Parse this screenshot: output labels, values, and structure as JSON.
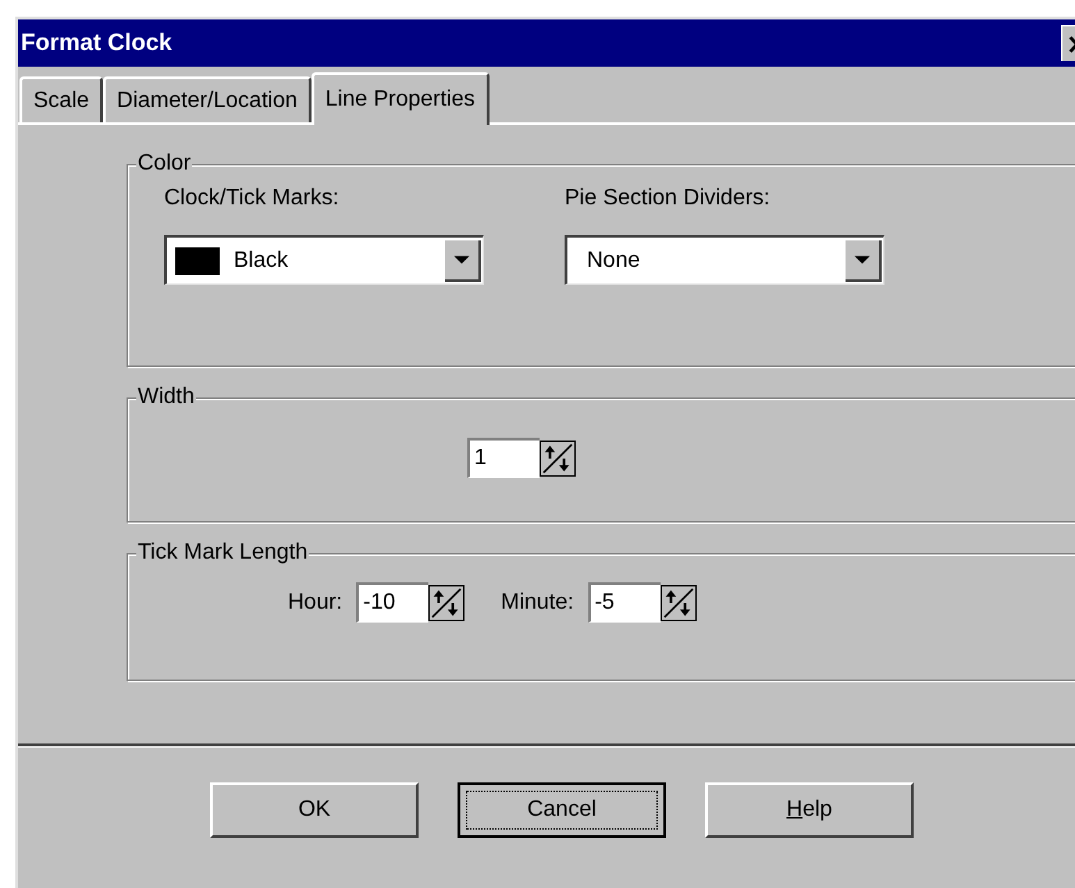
{
  "window": {
    "title": "Format Clock"
  },
  "tabs": [
    {
      "label": "Scale",
      "selected": false
    },
    {
      "label": "Diameter/Location",
      "selected": false
    },
    {
      "label": "Line Properties",
      "selected": true
    }
  ],
  "color_group": {
    "title": "Color",
    "fields": [
      {
        "label": "Clock/Tick Marks:",
        "value": "Black",
        "color": "#000000"
      },
      {
        "label": "Pie Section Dividers:",
        "value": "None"
      }
    ]
  },
  "width_group": {
    "title": "Width",
    "value": "1"
  },
  "tick_group": {
    "title": "Tick Mark Length",
    "fields": [
      {
        "label": "Hour:",
        "value": "-10"
      },
      {
        "label": "Minute:",
        "value": "-5"
      }
    ]
  },
  "buttons": [
    {
      "label": "OK",
      "default": false,
      "mnemonic": false
    },
    {
      "label": "Cancel",
      "default": true,
      "mnemonic": false
    },
    {
      "label": "Help",
      "default": false,
      "mnemonic": true
    }
  ]
}
